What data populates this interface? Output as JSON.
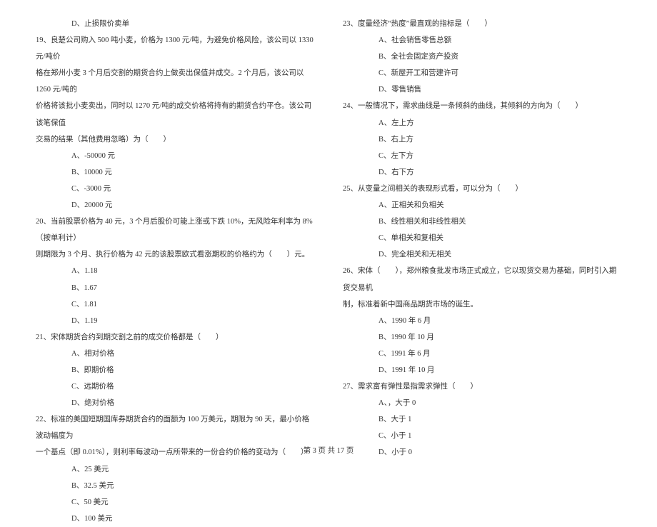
{
  "left": {
    "optD_prev": "D、止损限价卖单",
    "q19": "19、良楚公司购入 500 吨小麦，价格为 1300 元/吨，为避免价格风险，该公司以 1330 元/吨价",
    "q19_l2": "格在郑州小麦 3 个月后交割的期货合约上做卖出保值并成交。2 个月后，该公司以 1260 元/吨的",
    "q19_l3": "价格将该批小麦卖出，同时以 1270 元/吨的成交价格将持有的期货合约平仓。该公司该笔保值",
    "q19_l4": "交易的结果（其他费用忽略）为（　　）",
    "q19a": "A、-50000 元",
    "q19b": "B、10000 元",
    "q19c": "C、-3000 元",
    "q19d": "D、20000 元",
    "q20": "20、当前股票价格为 40 元，3 个月后股价可能上涨或下跌 10%，无风险年利率为 8%（按单利计）",
    "q20_l2": "则期限为 3 个月、执行价格为 42 元的该股票欧式看涨期权的价格约为（　　）元。",
    "q20a": "A、1.18",
    "q20b": "B、1.67",
    "q20c": "C、1.81",
    "q20d": "D、1.19",
    "q21": "21、宋体期货合约到期交割之前的成交价格都是（　　）",
    "q21a": "A、相对价格",
    "q21b": "B、即期价格",
    "q21c": "C、远期价格",
    "q21d": "D、绝对价格",
    "q22": "22、标准的美国短期国库券期货合约的面额为 100 万美元，期限为 90 天，最小价格波动幅度为",
    "q22_l2": "一个基点（即 0.01%），则利率每波动一点所带来的一份合约价格的变动为（　　）",
    "q22a": "A、25 美元",
    "q22b": "B、32.5 美元",
    "q22c": "C、50 美元",
    "q22d": "D、100 美元"
  },
  "right": {
    "q23": "23、度量经济“热度”最直观的指标是（　　）",
    "q23a": "A、社会销售零售总额",
    "q23b": "B、全社会固定资产投资",
    "q23c": "C、新屋开工和营建许可",
    "q23d": "D、零售销售",
    "q24": "24、一般情况下，需求曲线是一条倾斜的曲线，其倾斜的方向为（　　）",
    "q24a": "A、左上方",
    "q24b": "B、右上方",
    "q24c": "C、左下方",
    "q24d": "D、右下方",
    "q25": "25、从变量之间相关的表现形式看，可以分为（　　）",
    "q25a": "A、正相关和负相关",
    "q25b": "B、线性相关和非线性相关",
    "q25c": "C、单相关和复相关",
    "q25d": "D、完全相关和无相关",
    "q26": "26、宋体（　　），郑州粮食批发市场正式成立，它以现货交易为基础，同时引入期货交易机",
    "q26_l2": "制，标准着新中国商品期货市场的诞生。",
    "q26a": "A、1990 年 6 月",
    "q26b": "B、1990 年 10 月",
    "q26c": "C、1991 年 6 月",
    "q26d": "D、1991 年 10 月",
    "q27": "27、需求富有弹性是指需求弹性（　　）",
    "q27a": "A、，大于 0",
    "q27b": "B、大于 1",
    "q27c": "C、小于 1",
    "q27d": "D、小于 0"
  },
  "footer": "第 3 页 共 17 页"
}
